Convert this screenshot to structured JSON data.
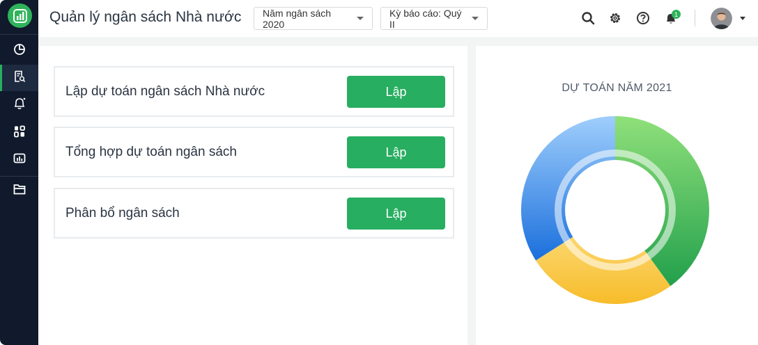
{
  "header": {
    "title": "Quản lý ngân sách Nhà nước",
    "year_select": "Năm ngân sách 2020",
    "period_select": "Kỳ báo cáo: Quý II",
    "notification_count": "1"
  },
  "sidebar": {
    "items": [
      {
        "icon": "pie-chart-icon"
      },
      {
        "icon": "document-search-icon",
        "active": true
      },
      {
        "icon": "bell-icon"
      },
      {
        "icon": "apps-grid-icon"
      },
      {
        "icon": "bar-chart-icon"
      },
      {
        "icon": "folder-icon"
      }
    ]
  },
  "tasks": [
    {
      "label": "Lập dự toán ngân sách Nhà nước",
      "button": "Lập"
    },
    {
      "label": "Tổng hợp dự toán ngân sách",
      "button": "Lập"
    },
    {
      "label": "Phân bổ ngân sách",
      "button": "Lập"
    }
  ],
  "chart": {
    "title": "DỰ TOÁN NĂM 2021"
  },
  "chart_data": {
    "type": "pie",
    "title": "DỰ TOÁN NĂM 2021",
    "slices": [
      {
        "value": 40,
        "color": "#3fb45a"
      },
      {
        "value": 26,
        "color": "#fbc840"
      },
      {
        "value": 34,
        "color": "#3a8ee6"
      }
    ]
  },
  "colors": {
    "accent": "#27ae60",
    "sidebar": "#101a2c"
  }
}
